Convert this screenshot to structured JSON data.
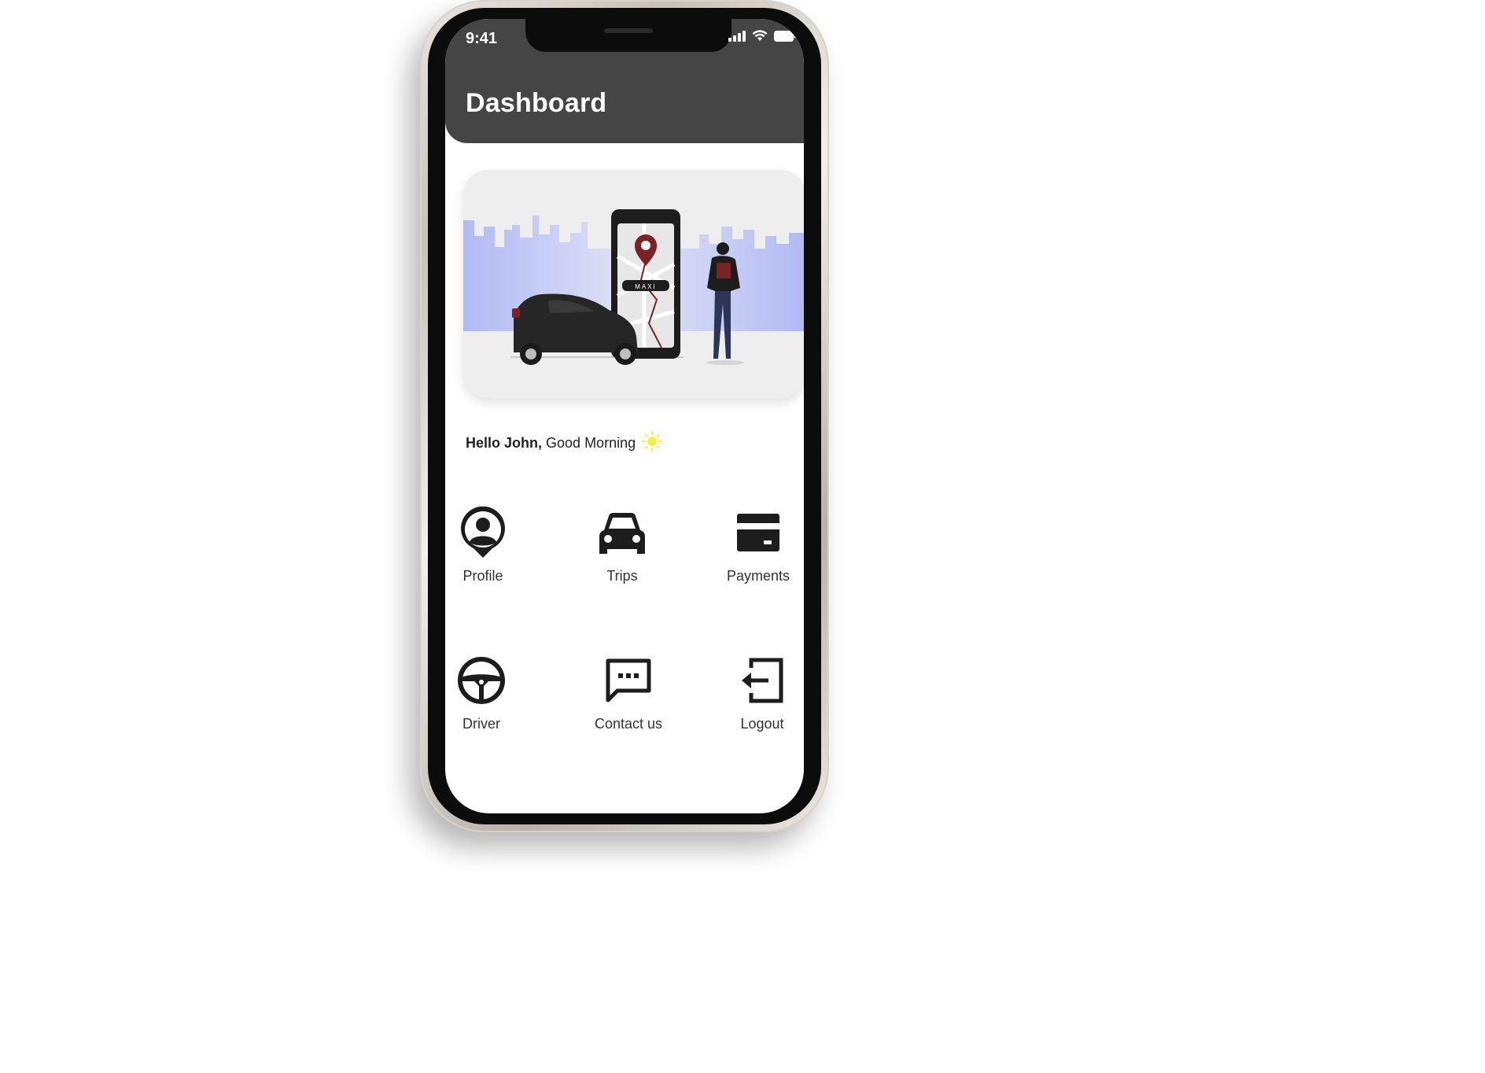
{
  "status_bar": {
    "time": "9:41"
  },
  "header": {
    "title": "Dashboard"
  },
  "hero": {
    "illustration": "taxi-booking-illustration",
    "phone_screen_label": "MAXI"
  },
  "greeting": {
    "name_part": "Hello John,",
    "message_part": "Good Morning",
    "icon": "sun-icon"
  },
  "menu": {
    "items": [
      {
        "label": "Profile",
        "icon": "profile-pin-icon"
      },
      {
        "label": "Trips",
        "icon": "car-icon"
      },
      {
        "label": "Payments",
        "icon": "credit-card-icon"
      },
      {
        "label": "Driver",
        "icon": "steering-wheel-icon"
      },
      {
        "label": "Contact us",
        "icon": "chat-icon"
      },
      {
        "label": "Logout",
        "icon": "logout-icon"
      }
    ]
  },
  "colors": {
    "header_bg": "#454545",
    "accent_red": "#7a2226",
    "sky_blue": "#aab4f5",
    "sun_yellow": "#f3f04a"
  }
}
